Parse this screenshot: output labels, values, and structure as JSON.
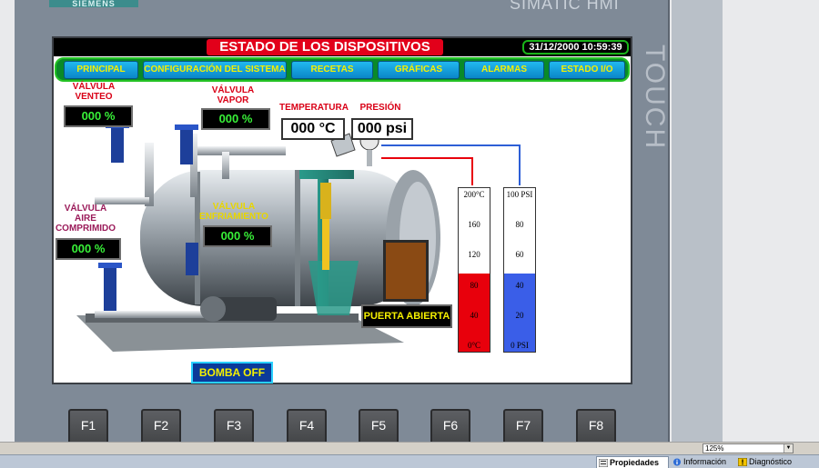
{
  "panel": {
    "brand": "SIEMENS",
    "model": "SIMATIC HMI",
    "side_label": "TOUCH"
  },
  "header": {
    "title": "ESTADO DE LOS DISPOSITIVOS",
    "datetime": "31/12/2000 10:59:39"
  },
  "nav": [
    {
      "label": "PRINCIPAL"
    },
    {
      "label": "CONFIGURACIÓN DEL SISTEMA"
    },
    {
      "label": "RECETAS"
    },
    {
      "label": "GRÁFICAS"
    },
    {
      "label": "ALARMAS"
    },
    {
      "label": "ESTADO I/O"
    }
  ],
  "valves": {
    "venteo": {
      "label1": "VÁLVULA",
      "label2": "VENTEO",
      "value": "000 %"
    },
    "vapor": {
      "label1": "VÁLVULA",
      "label2": "VAPOR",
      "value": "000 %"
    },
    "aire": {
      "label1": "VÁLVULA",
      "label2": "AIRE",
      "label3": "COMPRIMIDO",
      "value": "000 %"
    },
    "enfriamiento": {
      "label1": "VÁLVULA",
      "label2": "ENFRIAMIENTO",
      "value": "000 %"
    }
  },
  "readings": {
    "temp_label": "TEMPERATURA",
    "temp_value": "000 °C",
    "pres_label": "PRESIÓN",
    "pres_value": "000 psi"
  },
  "status": {
    "door": "PUERTA ABIERTA",
    "pump": "BOMBA OFF"
  },
  "gauges": {
    "temperature": {
      "ticks": [
        "200°C",
        "160",
        "120",
        "80",
        "40",
        "0°C"
      ],
      "fill_fraction": 0.48,
      "color": "#e8000c",
      "line_color": "#e8000c"
    },
    "pressure": {
      "ticks": [
        "100 PSI",
        "80",
        "60",
        "40",
        "20",
        "0 PSI"
      ],
      "fill_fraction": 0.48,
      "color": "#3a5ee8",
      "line_color": "#2d5fd6"
    }
  },
  "fkeys": [
    "F1",
    "F2",
    "F3",
    "F4",
    "F5",
    "F6",
    "F7",
    "F8"
  ],
  "editor": {
    "zoom": "125%",
    "tabs": [
      {
        "label": "Propiedades",
        "icon": "properties-icon"
      },
      {
        "label": "Información",
        "icon": "info-icon"
      },
      {
        "label": "Diagnóstico",
        "icon": "diagnostics-icon"
      }
    ]
  },
  "colors": {
    "title_bg": "#e2001a",
    "nav_button": "#1aa6e0",
    "nav_text": "#f5f000",
    "display_green": "#38f038"
  }
}
